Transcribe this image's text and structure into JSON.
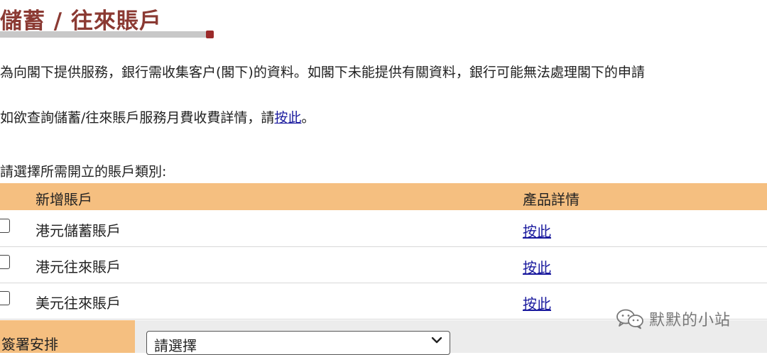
{
  "header": {
    "title": "儲蓄 / 往來賬戶"
  },
  "intro": {
    "text": "為向閣下提供服務，銀行需收集客户(閣下)的資料。如閣下未能提供有關資料，銀行可能無法處理閣下的申請"
  },
  "fees": {
    "text_before": "如欲查詢儲蓄/往來賬戶服務月費收費詳情，請",
    "link": "按此",
    "text_after": "。"
  },
  "account_select": {
    "prompt": "請選擇所需開立的賬戶類別:",
    "headers": {
      "new_account": "新增賬戶",
      "product_details": "產品詳情"
    },
    "rows": [
      {
        "name": "港元儲蓄賬戶",
        "link": "按此",
        "checked": false
      },
      {
        "name": "港元往來賬戶",
        "link": "按此",
        "checked": false
      },
      {
        "name": "美元往來賬戶",
        "link": "按此",
        "checked": false
      }
    ]
  },
  "signing": {
    "label": "簽署安排",
    "selected": "請選擇"
  },
  "watermark": {
    "text": "默默的小站",
    "icon": "wechat-icon"
  }
}
